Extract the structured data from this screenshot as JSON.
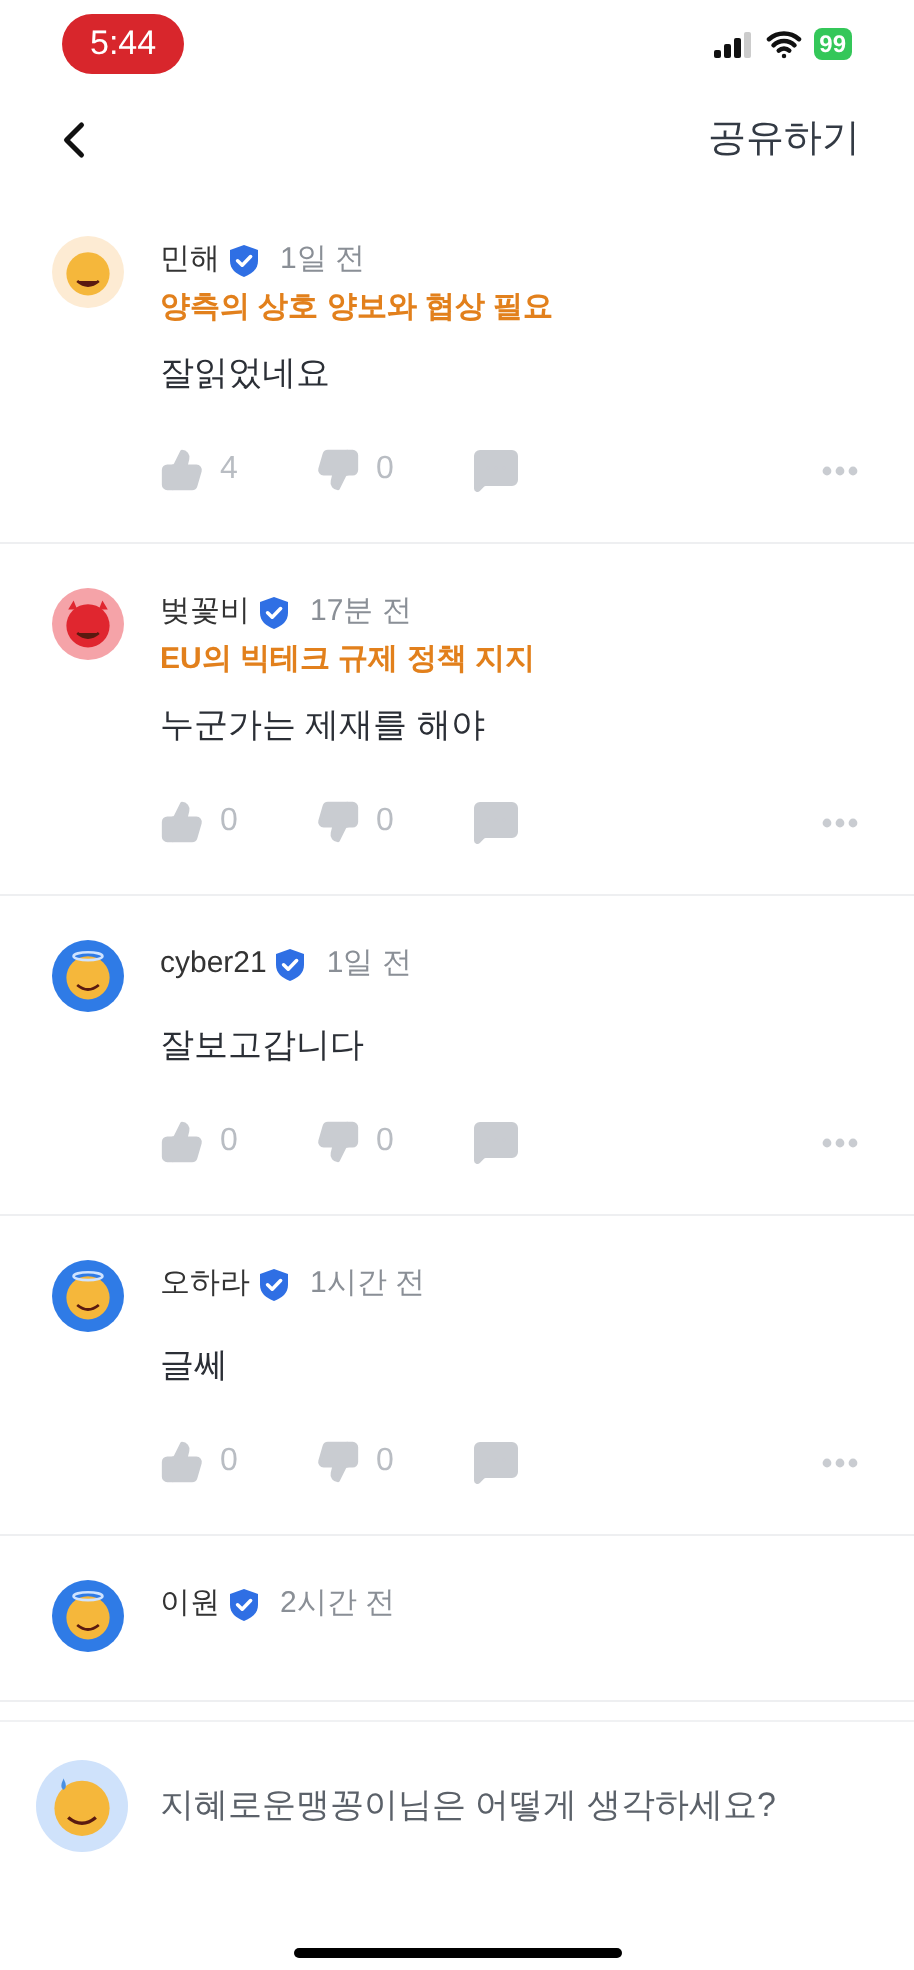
{
  "status_bar": {
    "time": "5:44",
    "battery": "99"
  },
  "header": {
    "share": "공유하기"
  },
  "comments": [
    {
      "avatar": {
        "kind": "laughing"
      },
      "name": "민해",
      "verified": true,
      "time": "1일 전",
      "stance": "양측의 상호 양보와 협상 필요",
      "text": "잘읽었네요",
      "likes": "4",
      "dislikes": "0"
    },
    {
      "avatar": {
        "kind": "devil"
      },
      "name": "벚꽃비",
      "verified": true,
      "time": "17분 전",
      "stance": "EU의 빅테크 규제 정책 지지",
      "text": "누군가는 제재를 해야",
      "likes": "0",
      "dislikes": "0"
    },
    {
      "avatar": {
        "kind": "halo"
      },
      "name": "cyber21",
      "verified": true,
      "time": "1일 전",
      "text": "잘보고갑니다",
      "likes": "0",
      "dislikes": "0"
    },
    {
      "avatar": {
        "kind": "halo"
      },
      "name": "오하라",
      "verified": true,
      "time": "1시간 전",
      "text": "글쎄",
      "likes": "0",
      "dislikes": "0"
    },
    {
      "avatar": {
        "kind": "halo"
      },
      "name": "이원",
      "verified": true,
      "time": "2시간 전"
    }
  ],
  "composer": {
    "avatar": {
      "kind": "sweat"
    },
    "placeholder": "지혜로운맹꽁이님은 어떻게 생각하세요?"
  }
}
